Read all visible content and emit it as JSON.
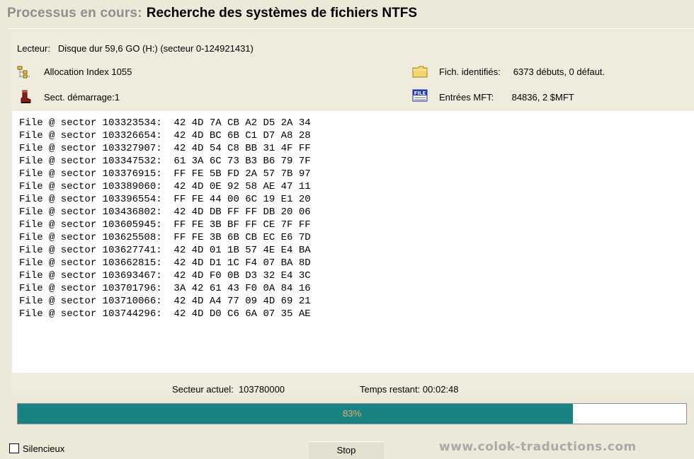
{
  "header": {
    "label": "Processus en cours:",
    "value": "Recherche des systèmes de fichiers NTFS"
  },
  "drive": {
    "label": "Lecteur:",
    "value": "Disque dur 59,6 GO (H:) (secteur 0-124921431)"
  },
  "allocation": {
    "icon": "tree-structure-icon",
    "text": "Allocation Index 1055"
  },
  "boot": {
    "icon": "boot-icon",
    "text": "Sect. démarrage:1"
  },
  "files": {
    "icon": "folder-icon",
    "label": "Fich. identifiés:",
    "value": "6373 débuts, 0 défaut."
  },
  "mft": {
    "icon": "file-mft-icon",
    "icon_text": "FILE",
    "label": "Entrées MFT:",
    "value": "84836, 2 $MFT"
  },
  "log": [
    "File @ sector 103323534:  42 4D 7A CB A2 D5 2A 34",
    "File @ sector 103326654:  42 4D BC 6B C1 D7 A8 28",
    "File @ sector 103327907:  42 4D 54 C8 BB 31 4F FF",
    "File @ sector 103347532:  61 3A 6C 73 B3 B6 79 7F",
    "File @ sector 103376915:  FF FE 5B FD 2A 57 7B 97",
    "File @ sector 103389060:  42 4D 0E 92 58 AE 47 11",
    "File @ sector 103396554:  FF FE 44 00 6C 19 E1 20",
    "File @ sector 103436802:  42 4D DB FF FF DB 20 06",
    "File @ sector 103605945:  FF FE 3B BF FF CE 7F FF",
    "File @ sector 103625508:  FF FE 3B 6B CB EC E6 7D",
    "File @ sector 103627741:  42 4D 01 1B 57 4E E4 BA",
    "File @ sector 103662815:  42 4D D1 1C F4 07 BA 8D",
    "File @ sector 103693467:  42 4D F0 0B D3 32 E4 3C",
    "File @ sector 103701796:  3A 42 61 43 F0 0A 84 16",
    "File @ sector 103710066:  42 4D A4 77 09 4D 69 21",
    "File @ sector 103744296:  42 4D D0 C6 6A 07 35 AE"
  ],
  "status": {
    "current_label": "Secteur actuel:",
    "current_value": "103780000",
    "remaining_label": "Temps restant:",
    "remaining_value": "00:02:48"
  },
  "progress": {
    "percent": 83,
    "label": "83%",
    "fill_color": "#178383",
    "text_color": "#f1a86d"
  },
  "footer": {
    "silent_label": "Silencieux",
    "stop_label": "Stop",
    "watermark": "www.colok-traductions.com"
  }
}
